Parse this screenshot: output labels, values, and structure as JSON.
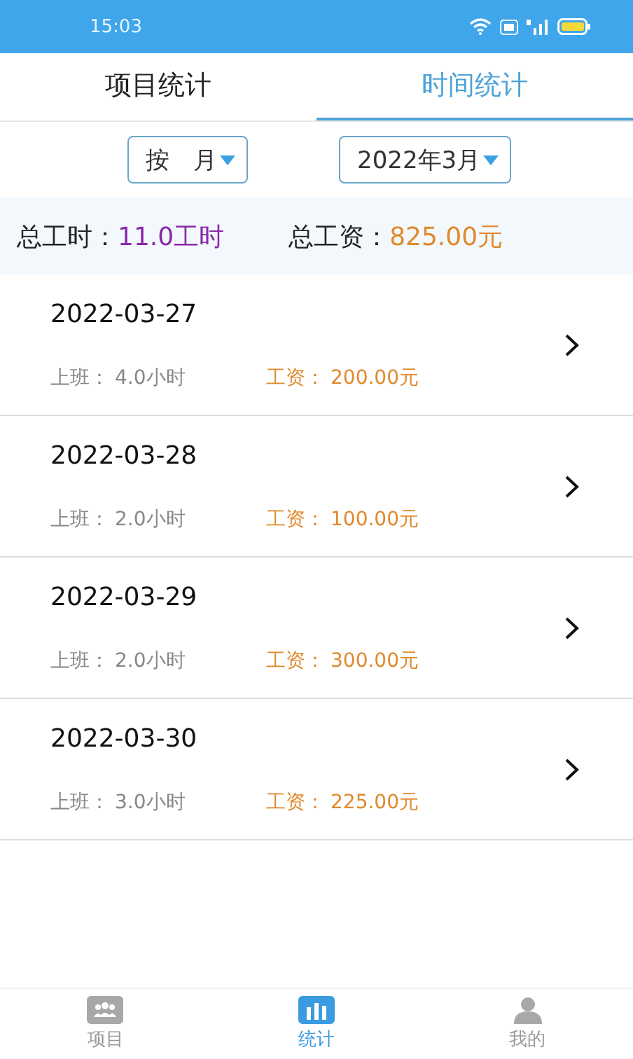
{
  "status_bar": {
    "time": "15:03"
  },
  "tabs": [
    {
      "label": "项目统计",
      "selected": false
    },
    {
      "label": "时间统计",
      "selected": true
    }
  ],
  "filters": [
    {
      "value": "按　月"
    },
    {
      "value": "2022年3月"
    }
  ],
  "summary": [
    {
      "label": "总工时：",
      "value": "11.0工时",
      "color": "#8a2aa8"
    },
    {
      "label": "总工资：",
      "value": "825.00元",
      "color": "#e08a2c"
    }
  ],
  "days": [
    {
      "date": "2022-03-27",
      "hours_label": "上班：",
      "hours": "4.0小时",
      "wage_label": "工资：",
      "wage": "200.00元"
    },
    {
      "date": "2022-03-28",
      "hours_label": "上班：",
      "hours": "2.0小时",
      "wage_label": "工资：",
      "wage": "100.00元"
    },
    {
      "date": "2022-03-29",
      "hours_label": "上班：",
      "hours": "2.0小时",
      "wage_label": "工资：",
      "wage": "300.00元"
    },
    {
      "date": "2022-03-30",
      "hours_label": "上班：",
      "hours": "3.0小时",
      "wage_label": "工资：",
      "wage": "225.00元"
    }
  ],
  "nav": [
    {
      "label": "项目",
      "kind": "group",
      "selected": false
    },
    {
      "label": "统计",
      "kind": "chart",
      "selected": true
    },
    {
      "label": "我的",
      "kind": "person",
      "selected": false
    }
  ]
}
